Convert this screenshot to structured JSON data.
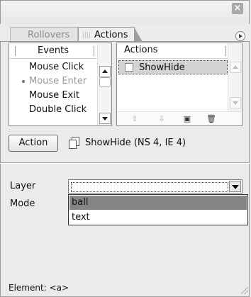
{
  "panel": {
    "tabs": [
      {
        "label": "Rollovers",
        "active": false
      },
      {
        "label": "Actions",
        "active": true
      }
    ]
  },
  "events": {
    "header": "Events",
    "items": [
      {
        "label": "Mouse Click",
        "muted": false
      },
      {
        "label": "Mouse Enter",
        "muted": true
      },
      {
        "label": "Mouse Exit",
        "muted": false
      },
      {
        "label": "Double Click",
        "muted": false
      }
    ]
  },
  "actions": {
    "header": "Actions",
    "items": [
      {
        "label": "ShowHide",
        "selected": true
      }
    ]
  },
  "action_row": {
    "button_label": "Action",
    "target_label": "ShowHide (NS 4, IE 4)"
  },
  "fields": {
    "layer_label": "Layer",
    "mode_label": "Mode",
    "layer_options": [
      "ball",
      "text"
    ],
    "layer_highlighted": "ball"
  },
  "status": {
    "element": "Element: <a>"
  },
  "colors": {
    "panel_bg": "#ecebe9",
    "selection": "#858585"
  },
  "icons": [
    "close-icon",
    "panel-menu-icon",
    "move-up-icon",
    "move-down-icon",
    "save-icon",
    "trash-icon",
    "showhide-icon"
  ]
}
